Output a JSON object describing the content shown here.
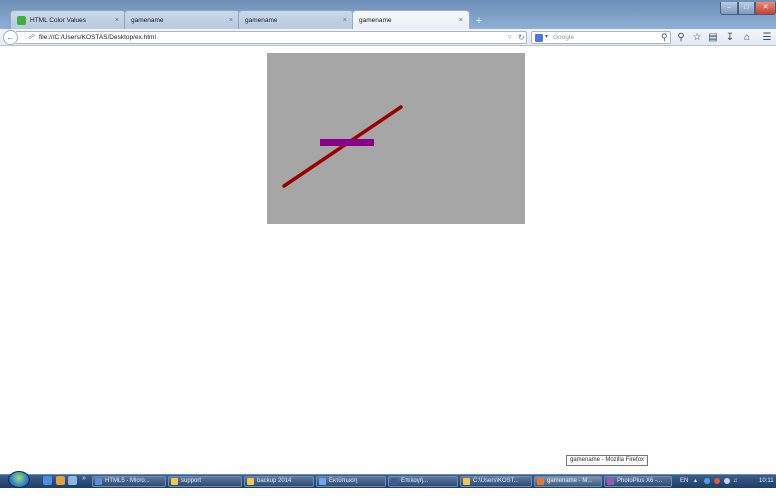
{
  "browser": {
    "tabs": [
      {
        "label": "HTML Color Values",
        "active": false,
        "favicon_color": "#3fae3b"
      },
      {
        "label": "gamename",
        "active": false
      },
      {
        "label": "gamename",
        "active": false
      },
      {
        "label": "gamename",
        "active": true
      }
    ],
    "tab_close_glyph": "×",
    "new_tab_glyph": "+",
    "address_bar": {
      "url": "file:///C:/Users/KOSTAS/Desktop/ex.html"
    },
    "search_bar": {
      "placeholder": "Google",
      "engine_icon": "google-icon"
    },
    "toolbar_icons": [
      "search-icon",
      "bookmark-star-icon",
      "bookmarks-menu-icon",
      "downloads-icon",
      "home-icon",
      "menu-icon"
    ]
  },
  "page": {
    "canvas": {
      "background": "#a6a6a6",
      "line_color": "#990000",
      "bar_color": "#8b008b"
    }
  },
  "tooltip": {
    "text": "gamename - Mozilla Firefox"
  },
  "taskbar": {
    "buttons": [
      {
        "label": "HTML5 - Micro...",
        "color": "#5a8fd6"
      },
      {
        "label": "support",
        "color": "#f2c94c"
      },
      {
        "label": "backup 2014",
        "color": "#f2c94c"
      },
      {
        "label": "Εκτύπωση",
        "color": "#6fa8e8"
      },
      {
        "label": "Επιλογή...",
        "color": "#3b5f8c"
      },
      {
        "label": "C:\\Users\\KOST...",
        "color": "#f2c94c"
      },
      {
        "label": "gamename - M...",
        "color": "#e8772e",
        "active": true
      },
      {
        "label": "PhotoPlus X6 -...",
        "color": "#9b59b6"
      }
    ],
    "tray": {
      "language": "EN",
      "time": "10:11 μμ"
    }
  }
}
